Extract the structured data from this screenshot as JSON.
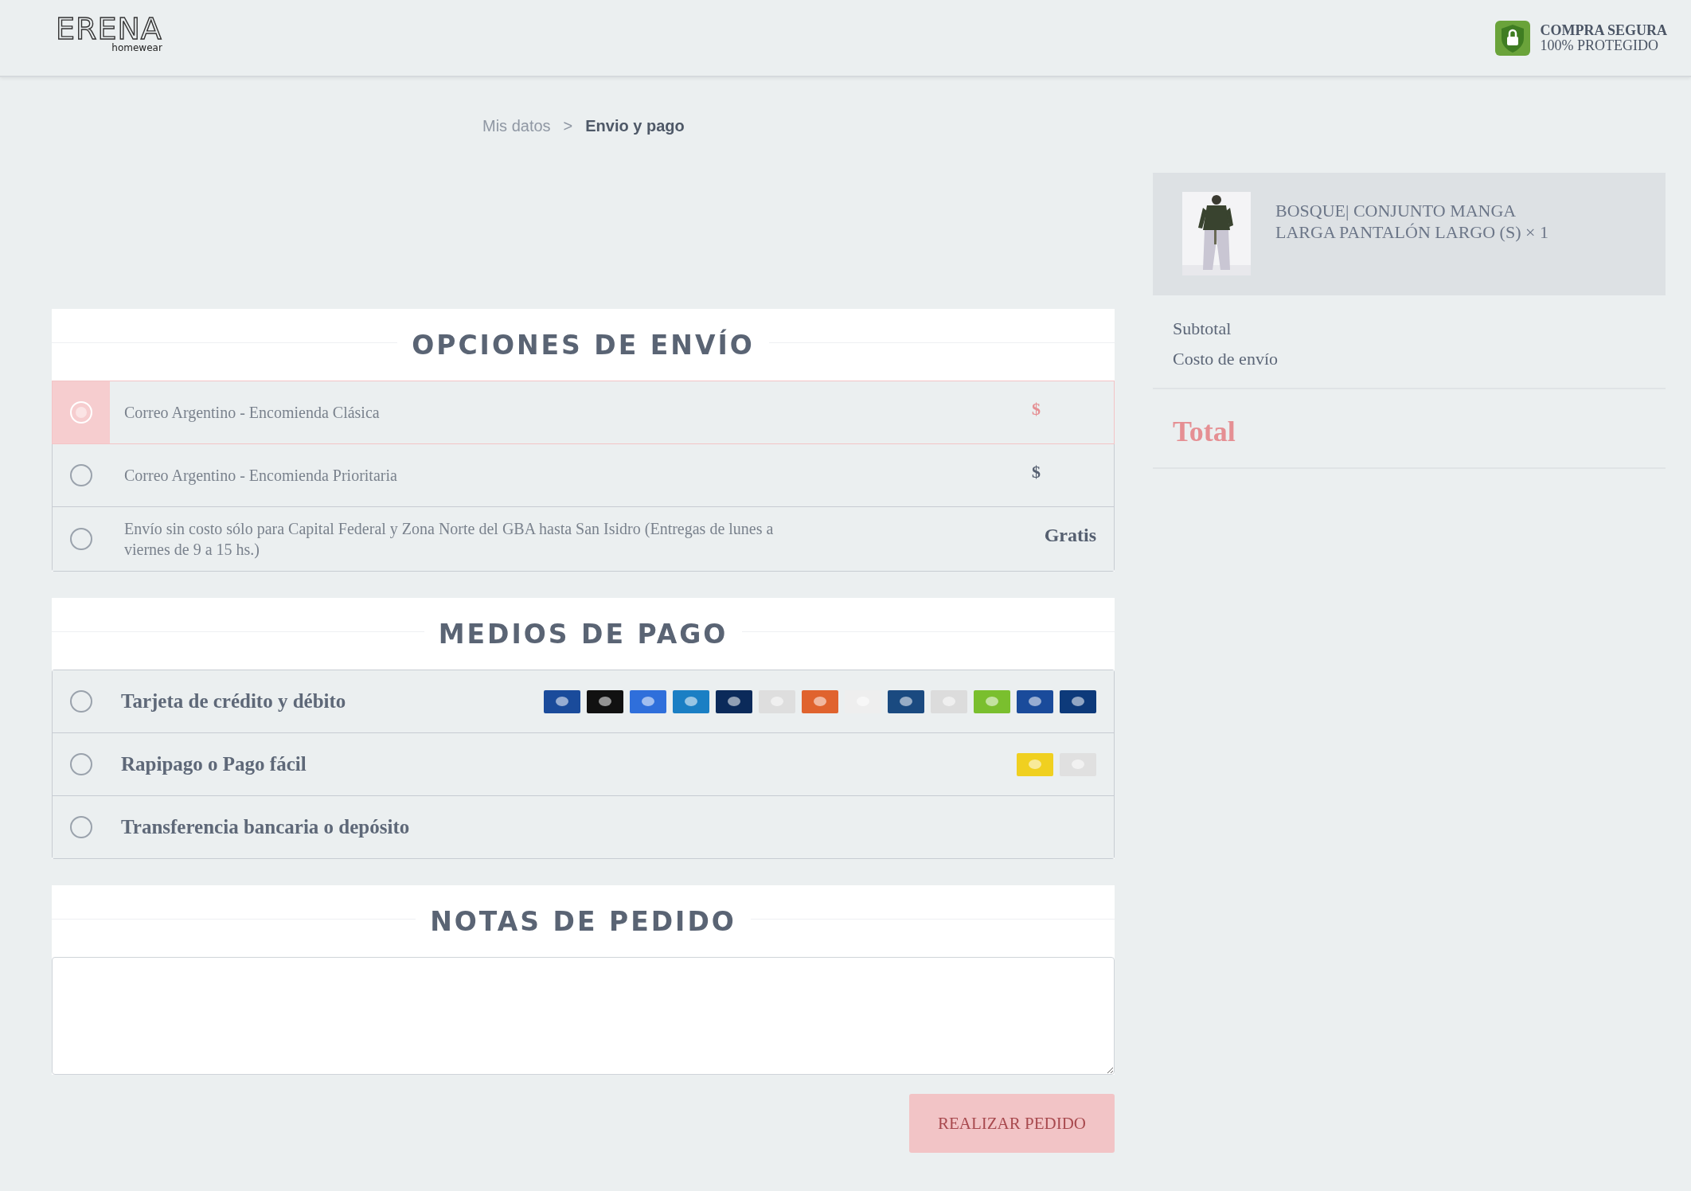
{
  "header": {
    "logo": {
      "name": "ERENA",
      "tagline": "homewear"
    },
    "secure_badge": {
      "title": "COMPRA SEGURA",
      "subtitle": "100% PROTEGIDO"
    }
  },
  "breadcrumb": {
    "separator": ">",
    "steps": [
      {
        "label": "Mis datos",
        "selected": false
      },
      {
        "label": "Envio y pago",
        "selected": true
      }
    ]
  },
  "shipping": {
    "title": "OPCIONES DE ENVÍO",
    "options": [
      {
        "label": "Correo Argentino - Encomienda Clásica",
        "price": "$",
        "selected": true
      },
      {
        "label": "Correo Argentino - Encomienda Prioritaria",
        "price": "$",
        "selected": false
      },
      {
        "label": "Envío sin costo sólo para Capital Federal y Zona Norte del GBA hasta San Isidro (Entregas de lunes a viernes de 9 a 15 hs.)",
        "price": "Gratis",
        "selected": false
      }
    ]
  },
  "payment": {
    "title": "MEDIOS DE PAGO",
    "methods": [
      {
        "label": "Tarjeta de crédito y débito",
        "selected": false,
        "logos": [
          {
            "color": "#1a4b9b"
          },
          {
            "color": "#111111"
          },
          {
            "color": "#2f6fdb"
          },
          {
            "color": "#1a7fc4"
          },
          {
            "color": "#0b2a5a"
          },
          {
            "color": "#dedede"
          },
          {
            "color": "#e0632e"
          },
          {
            "color": "#eeeeee"
          },
          {
            "color": "#1a4a80"
          },
          {
            "color": "#dcdcdc"
          },
          {
            "color": "#7abf2e"
          },
          {
            "color": "#1a4b9b"
          },
          {
            "color": "#0d3a7a"
          }
        ]
      },
      {
        "label": "Rapipago o Pago fácil",
        "selected": false,
        "logos": [
          {
            "color": "#f0d020"
          },
          {
            "color": "#e0e0e0"
          }
        ]
      },
      {
        "label": "Transferencia bancaria o depósito",
        "selected": false
      }
    ]
  },
  "notes": {
    "title": "NOTAS DE PEDIDO"
  },
  "submit": {
    "label": "REALIZAR PEDIDO",
    "disabled": true
  },
  "summary": {
    "items": [
      {
        "name": "BOSQUE| CONJUNTO MANGA LARGA PANTALÓN LARGO (S) × 1"
      }
    ],
    "lines": [
      {
        "label": "Subtotal"
      },
      {
        "label": "Costo de envío"
      }
    ],
    "total": {
      "label": "Total"
    }
  }
}
